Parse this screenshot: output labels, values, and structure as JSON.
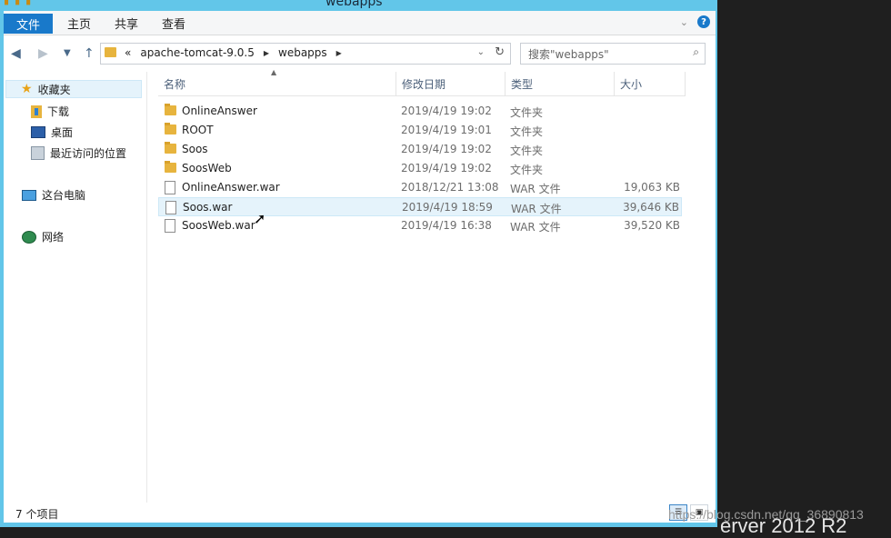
{
  "window": {
    "title": "webapps"
  },
  "ribbon": {
    "tabs": [
      "文件",
      "主页",
      "共享",
      "查看"
    ],
    "help": "?"
  },
  "address": {
    "crumbs": [
      "«",
      "apache-tomcat-9.0.5",
      "webapps"
    ],
    "search_placeholder": "搜索\"webapps\""
  },
  "nav_pane": {
    "items": [
      "收藏夹",
      "下载",
      "桌面",
      "最近访问的位置",
      "这台电脑",
      "网络"
    ]
  },
  "columns": [
    "名称",
    "修改日期",
    "类型",
    "大小"
  ],
  "files": [
    {
      "name": "OnlineAnswer",
      "date": "2019/4/19 19:02",
      "type": "文件夹",
      "size": "",
      "icon": "folder-icon"
    },
    {
      "name": "ROOT",
      "date": "2019/4/19 19:01",
      "type": "文件夹",
      "size": "",
      "icon": "folder-icon"
    },
    {
      "name": "Soos",
      "date": "2019/4/19 19:02",
      "type": "文件夹",
      "size": "",
      "icon": "folder-icon"
    },
    {
      "name": "SoosWeb",
      "date": "2019/4/19 19:02",
      "type": "文件夹",
      "size": "",
      "icon": "folder-icon"
    },
    {
      "name": "OnlineAnswer.war",
      "date": "2018/12/21 13:08",
      "type": "WAR 文件",
      "size": "19,063 KB",
      "icon": "file-icon"
    },
    {
      "name": "Soos.war",
      "date": "2019/4/19 18:59",
      "type": "WAR 文件",
      "size": "39,646 KB",
      "icon": "file-icon"
    },
    {
      "name": "SoosWeb.war",
      "date": "2019/4/19 16:38",
      "type": "WAR 文件",
      "size": "39,520 KB",
      "icon": "file-icon"
    }
  ],
  "status": {
    "count": "7 个项目"
  },
  "desktop": {
    "os_text": "erver 2012 R2",
    "watermark": "https://blog.csdn.net/qq_36890813"
  },
  "colors": {
    "accent": "#1979ca",
    "frame": "#62c6e9",
    "folder": "#e7b43e"
  }
}
